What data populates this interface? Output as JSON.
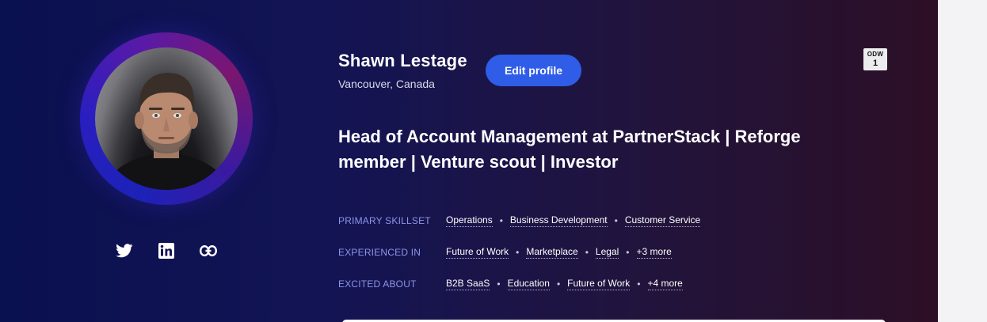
{
  "profile": {
    "name": "Shawn Lestage",
    "location": "Vancouver, Canada",
    "edit_label": "Edit profile",
    "headline": "Head of Account Management at PartnerStack | Reforge member | Venture scout | Investor"
  },
  "badge": {
    "line1": "ODW",
    "line2": "1"
  },
  "socials": [
    "twitter-icon",
    "linkedin-icon",
    "link-icon"
  ],
  "skills": {
    "primary": {
      "label": "PRIMARY SKILLSET",
      "items": [
        "Operations",
        "Business Development",
        "Customer Service"
      ]
    },
    "experienced": {
      "label": "EXPERIENCED IN",
      "items": [
        "Future of Work",
        "Marketplace",
        "Legal",
        "+3 more"
      ]
    },
    "excited": {
      "label": "EXCITED ABOUT",
      "items": [
        "B2B SaaS",
        "Education",
        "Future of Work",
        "+4 more"
      ]
    }
  },
  "colors": {
    "accent": "#2f5de8",
    "label": "#8c95ea",
    "background_start": "#0a1150",
    "background_end": "#2c0f25"
  }
}
